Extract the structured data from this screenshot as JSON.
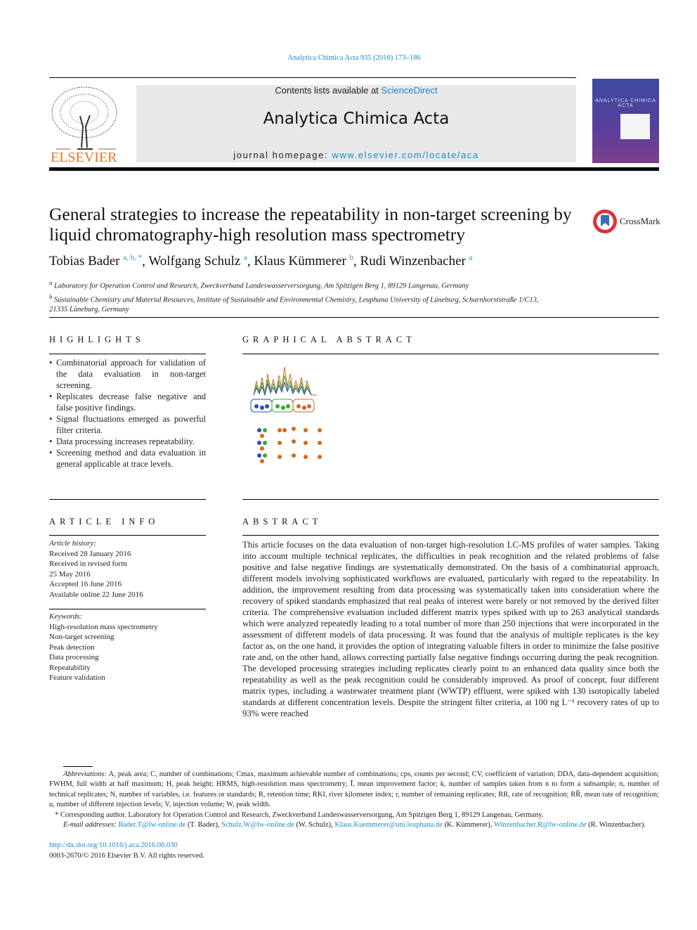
{
  "header": {
    "journal_ref": "Analytica Chimica Acta 935 (2016) 173–186",
    "contents_prefix": "Contents lists available at ",
    "contents_link": "ScienceDirect",
    "journal_title": "Analytica Chimica Acta",
    "homepage_prefix": "journal homepage: ",
    "homepage_link": "www.elsevier.com/locate/aca",
    "publisher_logo": "ELSEVIER",
    "cover_title": "ANALYTICA CHIMICA ACTA"
  },
  "article": {
    "title": "General strategies to increase the repeatability in non-target screening by liquid chromatography-high resolution mass spectrometry",
    "crossmark": "CrossMark",
    "authors": [
      {
        "name": "Tobias Bader",
        "sup": "a, b, *"
      },
      {
        "name": "Wolfgang Schulz",
        "sup": "a"
      },
      {
        "name": "Klaus Kümmerer",
        "sup": "b"
      },
      {
        "name": "Rudi Winzenbacher",
        "sup": "a"
      }
    ],
    "affiliations": [
      {
        "sup": "a",
        "text": "Laboratory for Operation Control and Research, Zweckverband Landeswasserversorgung, Am Spitzigen Berg 1, 89129 Langenau, Germany"
      },
      {
        "sup": "b",
        "text": "Sustainable Chemistry and Material Resources, Institute of Sustainable and Environmental Chemistry, Leuphana University of Lüneburg, Scharnhorststraße 1/C13, 21335 Lüneburg, Germany"
      }
    ]
  },
  "highlights": {
    "heading": "HIGHLIGHTS",
    "items": [
      "Combinatorial approach for validation of the data evaluation in non-target screening.",
      "Replicates decrease false negative and false positive findings.",
      "Signal fluctuations emerged as powerful filter criteria.",
      "Data processing increases repeatability.",
      "Screening method and data evaluation in general applicable at trace levels."
    ]
  },
  "graphical_abstract": {
    "heading": "GRAPHICAL ABSTRACT"
  },
  "article_info": {
    "heading": "ARTICLE INFO",
    "history_label": "Article history:",
    "history": [
      "Received 28 January 2016",
      "Received in revised form",
      "25 May 2016",
      "Accepted 16 June 2016",
      "Available online 22 June 2016"
    ],
    "keywords_label": "Keywords:",
    "keywords": [
      "High-resolution mass spectrometry",
      "Non-target screening",
      "Peak detection",
      "Data processing",
      "Repeatability",
      "Feature validation"
    ]
  },
  "abstract": {
    "heading": "ABSTRACT",
    "text": "This article focuses on the data evaluation of non-target high-resolution LC-MS profiles of water samples. Taking into account multiple technical replicates, the difficulties in peak recognition and the related problems of false positive and false negative findings are systematically demonstrated. On the basis of a combinatorial approach, different models involving sophisticated workflows are evaluated, particularly with regard to the repeatability. In addition, the improvement resulting from data processing was systematically taken into consideration where the recovery of spiked standards emphasized that real peaks of interest were barely or not removed by the derived filter criteria. The comprehensive evaluation included different matrix types spiked with up to 263 analytical standards which were analyzed repeatedly leading to a total number of more than 250 injections that were incorporated in the assessment of different models of data processing. It was found that the analysis of multiple replicates is the key factor as, on the one hand, it provides the option of integrating valuable filters in order to minimize the false positive rate and, on the other hand, allows correcting partially false negative findings occurring during the peak recognition. The developed processing strategies including replicates clearly point to an enhanced data quality since both the repeatability as well as the peak recognition could be considerably improved. As proof of concept, four different matrix types, including a wastewater treatment plant (WWTP) effluent, were spiked with 130 isotopically labeled standards at different concentration levels. Despite the stringent filter criteria, at 100 ng L⁻¹ recovery rates of up to 93% were reached"
  },
  "footnotes": {
    "abbreviations_label": "Abbreviations:",
    "abbreviations": "A, peak area; C, number of combinations; Cmax, maximum achievable number of combinations; cps, counts per second; CV, coefficient of variation; DDA, data-dependent acquisition; FWHM, full width at half maximum; H, peak height; HRMS, high-resolution mass spectrometry; Ī, mean improvement factor; k, number of samples taken from n to form a subsample; n, number of technical replicates; N, number of variables, i.e. features or standards; R, retention time; RKI, river kilometer index; r, number of remaining replicates; RR, rate of recognition; RR̅, mean rate of recognition; u, number of different injection levels; V, injection volume; W, peak width.",
    "corresponding": "* Corresponding author. Laboratory for Operation Control and Research, Zweckverband Landeswasserversorgung, Am Spitzigen Berg 1, 89129 Langenau, Germany.",
    "email_label": "E-mail addresses:",
    "emails": [
      {
        "addr": "Bader.T@lw-online.de",
        "who": " (T. Bader), "
      },
      {
        "addr": "Schulz.W@lw-online.de",
        "who": " (W. Schulz), "
      },
      {
        "addr": "Klaus.Kuemmerer@uni.leuphana.de",
        "who": " (K. Kümmerer), "
      },
      {
        "addr": "Winzenbacher.R@lw-online.de",
        "who": " (R. Winzenbacher)."
      }
    ],
    "doi": "http://dx.doi.org/10.1016/j.aca.2016.06.030",
    "copyright": "0003-2670/© 2016 Elsevier B.V. All rights reserved."
  },
  "colors": {
    "link": "#1a8ac9",
    "banner": "#e8e8e8",
    "elsevier_orange": "#e87722"
  }
}
